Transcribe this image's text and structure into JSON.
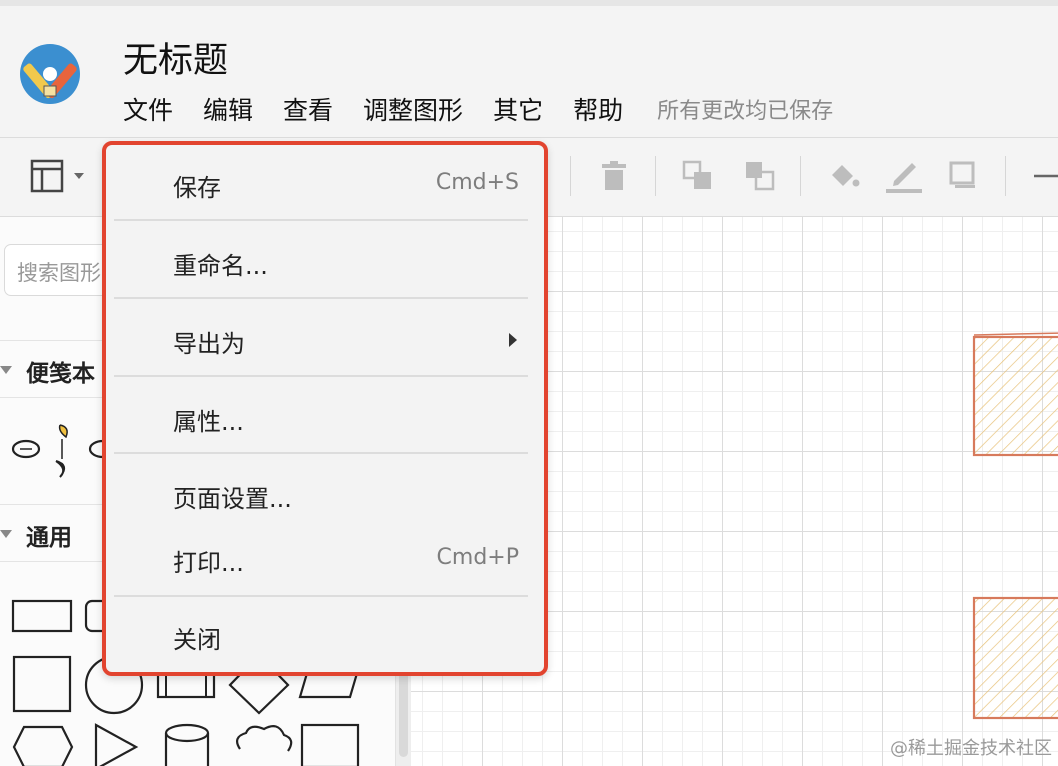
{
  "app": {
    "title": "无标题"
  },
  "menubar": {
    "items": [
      "文件",
      "编辑",
      "查看",
      "调整图形",
      "其它",
      "帮助"
    ],
    "status": "所有更改均已保存"
  },
  "sidebar": {
    "search_placeholder": "搜索图形",
    "sections": [
      {
        "label": "便笺本"
      },
      {
        "label": "通用"
      }
    ]
  },
  "file_menu": {
    "items": [
      {
        "label": "保存",
        "shortcut": "Cmd+S"
      },
      {
        "label": "重命名..."
      },
      {
        "label": "导出为",
        "has_submenu": true
      },
      {
        "label": "属性..."
      },
      {
        "label": "页面设置..."
      },
      {
        "label": "打印...",
        "shortcut": "Cmd+P"
      },
      {
        "label": "关闭"
      }
    ]
  },
  "colors": {
    "highlight": "#e2442f",
    "sketch_stroke": "#d77a5c",
    "sketch_fill": "#e8c27a"
  },
  "watermark": "@稀土掘金技术社区"
}
